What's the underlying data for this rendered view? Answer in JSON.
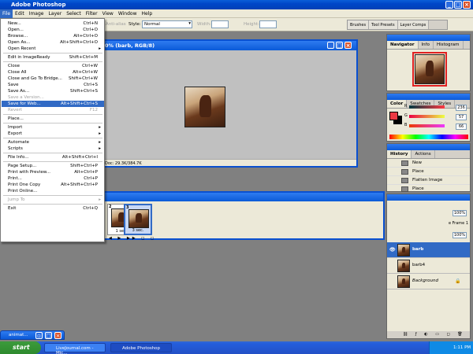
{
  "app": {
    "title": "Adobe Photoshop"
  },
  "menubar": [
    "File",
    "Edit",
    "Image",
    "Layer",
    "Select",
    "Filter",
    "View",
    "Window",
    "Help"
  ],
  "options": {
    "style_label": "Style:",
    "style_value": "Normal",
    "width_label": "Width:",
    "height_label": "Height:",
    "antialias_label": "Anti-alias"
  },
  "palette_well": [
    "Brushes",
    "Tool Presets",
    "Layer Comps"
  ],
  "file_menu": [
    {
      "label": "New...",
      "shortcut": "Ctrl+N"
    },
    {
      "label": "Open...",
      "shortcut": "Ctrl+O"
    },
    {
      "label": "Browse...",
      "shortcut": "Alt+Ctrl+O"
    },
    {
      "label": "Open As...",
      "shortcut": "Alt+Shift+Ctrl+O"
    },
    {
      "label": "Open Recent",
      "submenu": true
    },
    {
      "sep": true
    },
    {
      "label": "Edit in ImageReady",
      "shortcut": "Shift+Ctrl+M"
    },
    {
      "sep": true
    },
    {
      "label": "Close",
      "shortcut": "Ctrl+W"
    },
    {
      "label": "Close All",
      "shortcut": "Alt+Ctrl+W"
    },
    {
      "label": "Close and Go To Bridge...",
      "shortcut": "Shift+Ctrl+W"
    },
    {
      "label": "Save",
      "shortcut": "Ctrl+S"
    },
    {
      "label": "Save As...",
      "shortcut": "Shift+Ctrl+S"
    },
    {
      "label": "Save a Version...",
      "disabled": true
    },
    {
      "label": "Save for Web...",
      "shortcut": "Alt+Shift+Ctrl+S",
      "highlighted": true
    },
    {
      "label": "Revert",
      "shortcut": "F12",
      "disabled": true
    },
    {
      "sep": true
    },
    {
      "label": "Place..."
    },
    {
      "sep": true
    },
    {
      "label": "Import",
      "submenu": true
    },
    {
      "label": "Export",
      "submenu": true
    },
    {
      "sep": true
    },
    {
      "label": "Automate",
      "submenu": true
    },
    {
      "label": "Scripts",
      "submenu": true
    },
    {
      "sep": true
    },
    {
      "label": "File Info...",
      "shortcut": "Alt+Shift+Ctrl+I"
    },
    {
      "sep": true
    },
    {
      "label": "Page Setup...",
      "shortcut": "Shift+Ctrl+P"
    },
    {
      "label": "Print with Preview...",
      "shortcut": "Alt+Ctrl+P"
    },
    {
      "label": "Print...",
      "shortcut": "Ctrl+P"
    },
    {
      "label": "Print One Copy",
      "shortcut": "Alt+Shift+Ctrl+P"
    },
    {
      "label": "Print Online..."
    },
    {
      "sep": true
    },
    {
      "label": "Jump To",
      "submenu": true,
      "disabled": true
    },
    {
      "sep": true
    },
    {
      "label": "Exit",
      "shortcut": "Ctrl+Q"
    }
  ],
  "document": {
    "title_suffix": "0% (barb, RGB/8)",
    "status": "Doc: 29.3K/384.7K"
  },
  "animation": {
    "frames": [
      {
        "num": "2",
        "delay": "1 sec."
      },
      {
        "num": "3",
        "delay": "3 sec."
      }
    ]
  },
  "navigator": {
    "tabs": [
      "Navigator",
      "Info",
      "Histogram"
    ]
  },
  "color": {
    "tabs": [
      "Color",
      "Swatches",
      "Styles"
    ],
    "r": "236",
    "g": "57",
    "b": "66",
    "r_label": "R",
    "g_label": "G",
    "b_label": "B",
    "fg": "#ec3942"
  },
  "history": {
    "tabs": [
      "History",
      "Actions"
    ],
    "items": [
      "New",
      "Place",
      "Flatten Image",
      "Place"
    ]
  },
  "layers": {
    "opacity": "100%",
    "fill": "100%",
    "propagate": "e Frame 1",
    "items": [
      {
        "name": "barb",
        "selected": true
      },
      {
        "name": "barb4"
      },
      {
        "name": "Background",
        "italic": true
      }
    ]
  },
  "taskbar": {
    "start": "start",
    "tasks": [
      "LiveJournal.com - Mic...",
      "Adobe Photoshop"
    ],
    "time": "1:11 PM",
    "minimized": "animat..."
  }
}
